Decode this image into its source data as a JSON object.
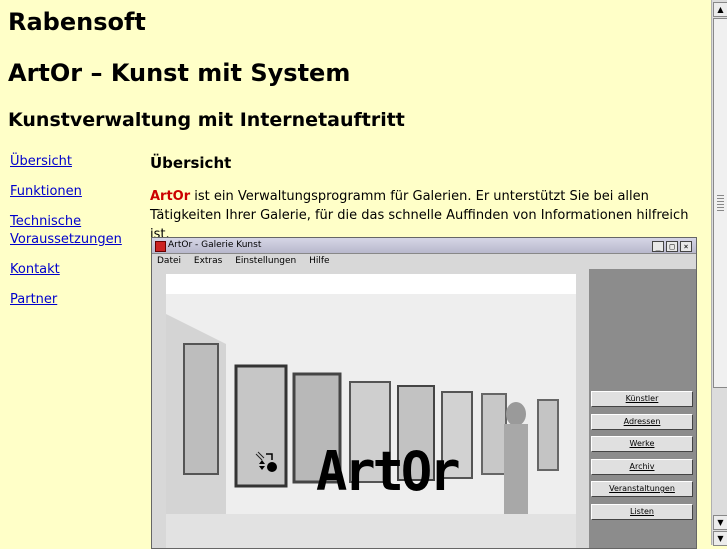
{
  "header": {
    "brand": "Rabensoft",
    "title": "ArtOr – Kunst mit System",
    "subtitle": "Kunstverwaltung mit Internetauftritt"
  },
  "nav": {
    "items": [
      {
        "label": "Übersicht"
      },
      {
        "label": "Funktionen"
      },
      {
        "label": "Technische Voraussetzungen"
      },
      {
        "label": "Kontakt"
      },
      {
        "label": "Partner"
      }
    ]
  },
  "content": {
    "heading": "Übersicht",
    "intro_brand": "ArtOr",
    "intro_text": " ist ein Verwaltungsprogramm für Galerien. Er unterstützt Sie bei allen Tätigkeiten Ihrer Galerie, für die das schnelle Auffinden von Informationen hilfreich ist."
  },
  "app_window": {
    "title": "ArtOr - Galerie Kunst",
    "window_buttons": [
      "_",
      "□",
      "×"
    ],
    "menu": [
      "Datei",
      "Extras",
      "Einstellungen",
      "Hilfe"
    ],
    "logo_text": "ArtOr",
    "side_buttons": [
      "Künstler",
      "Adressen",
      "Werke",
      "Archiv",
      "Veranstaltungen",
      "Listen"
    ]
  },
  "colors": {
    "page_background": "#ffffc8",
    "link": "#0000cc",
    "brand_accent": "#cc0000"
  },
  "scrollbar": {
    "up_icon": "arrow-up-icon",
    "down_icon": "arrow-down-icon"
  }
}
